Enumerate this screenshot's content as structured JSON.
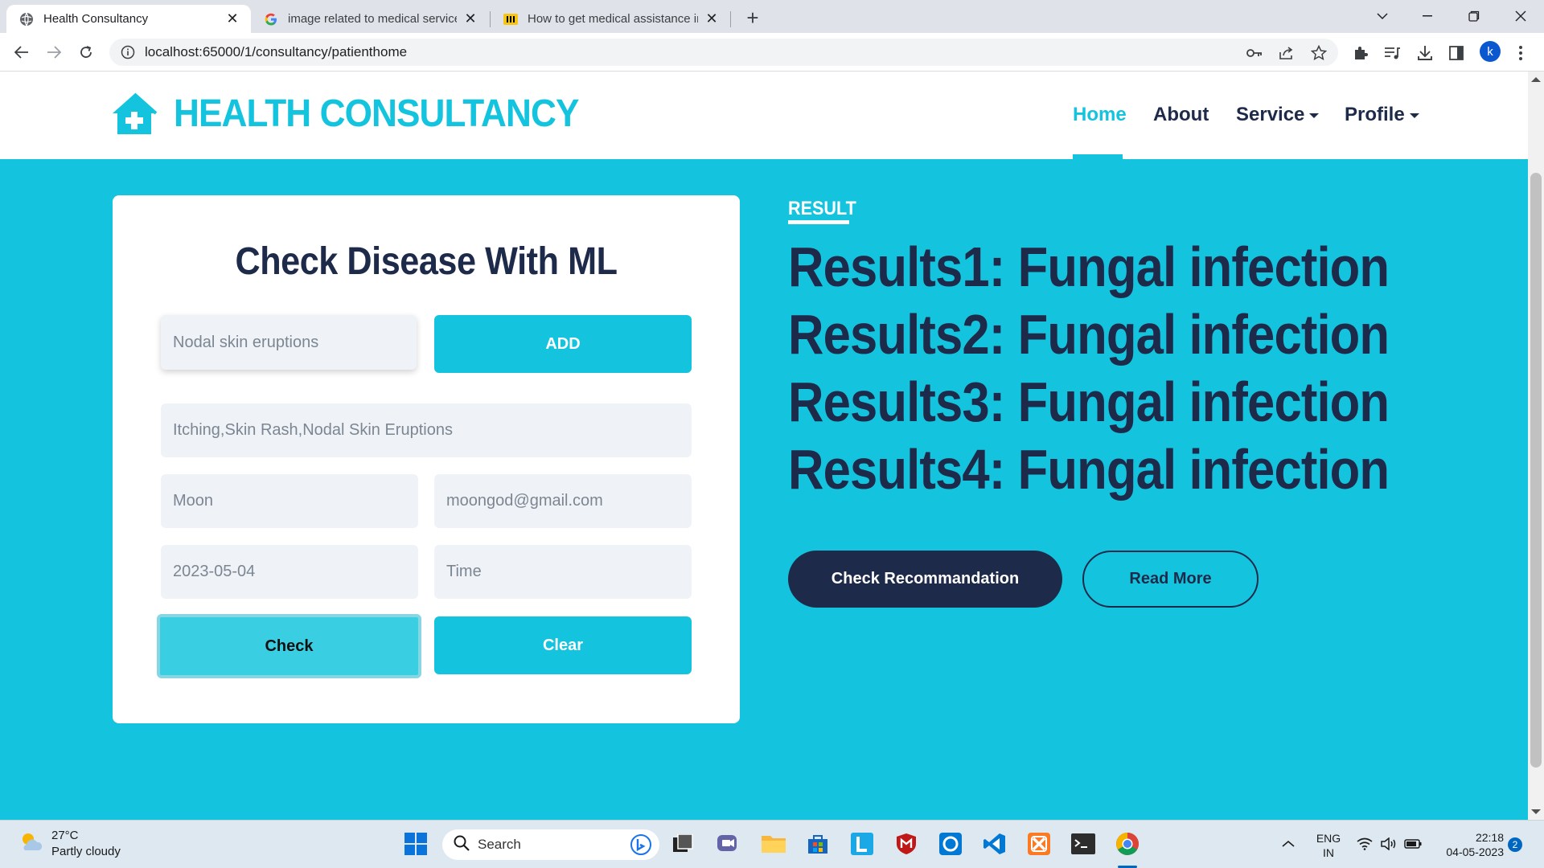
{
  "browser": {
    "tabs": [
      {
        "title": "Health Consultancy",
        "active": true
      },
      {
        "title": "image related to medical services",
        "active": false
      },
      {
        "title": "How to get medical assistance in",
        "active": false
      }
    ],
    "url": "localhost:65000/1/consultancy/patienthome",
    "profile_initial": "k"
  },
  "site": {
    "brand": "HEALTH CONSULTANCY",
    "nav": {
      "home": "Home",
      "about": "About",
      "service": "Service",
      "profile": "Profile"
    }
  },
  "form": {
    "title": "Check Disease With ML",
    "symptom_input": "Nodal skin eruptions",
    "add_label": "ADD",
    "symptoms_list": "Itching,Skin Rash,Nodal Skin Eruptions",
    "name": "Moon",
    "email": "moongod@gmail.com",
    "date": "2023-05-04",
    "time_placeholder": "Time",
    "check_label": "Check",
    "clear_label": "Clear"
  },
  "result": {
    "label": "RESULT",
    "lines": [
      "Results1: Fungal infection",
      "Results2: Fungal infection",
      "Results3: Fungal infection",
      "Results4: Fungal infection"
    ],
    "recommend_label": "Check Recommandation",
    "read_more_label": "Read More"
  },
  "taskbar": {
    "weather_temp": "27°C",
    "weather_desc": "Partly cloudy",
    "search_label": "Search",
    "lang_top": "ENG",
    "lang_bottom": "IN",
    "time": "22:18",
    "date": "04-05-2023",
    "notification_count": "2"
  },
  "colors": {
    "accent": "#14c4de",
    "navy": "#1e2a4a"
  }
}
